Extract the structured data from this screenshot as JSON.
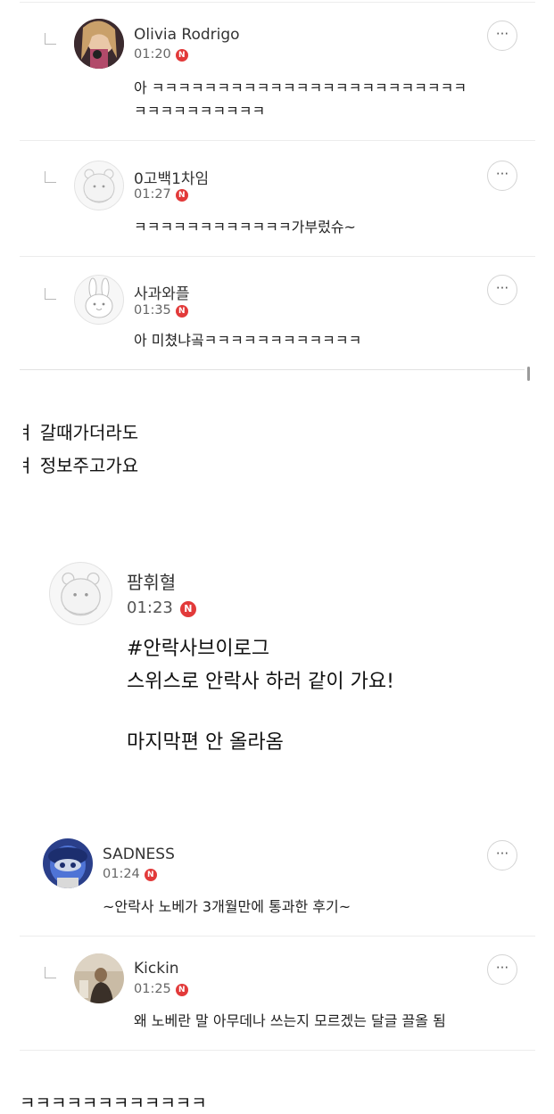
{
  "comments_top": [
    {
      "name": "Olivia Rodrigo",
      "time": "01:20",
      "text_line1": "아 ㅋㅋㅋㅋㅋㅋㅋㅋㅋㅋㅋㅋㅋㅋㅋㅋㅋㅋㅋㅋㅋㅋㅋㅋ",
      "text_line2": "ㅋㅋㅋㅋㅋㅋㅋㅋㅋㅋ"
    },
    {
      "name": "0고백1차임",
      "time": "01:27",
      "text_line1": "ㅋㅋㅋㅋㅋㅋㅋㅋㅋㅋㅋㅋ가부렀슈~"
    },
    {
      "name": "사과와플",
      "time": "01:35",
      "text_line1": "아 미쳤냐곸ㅋㅋㅋㅋㅋㅋㅋㅋㅋㅋㅋㅋ"
    }
  ],
  "badge_letter": "N",
  "more_label": "···",
  "mid_text": {
    "line1": "ㅕ 갈때가더라도",
    "line2": "ㅕ 정보주고가요"
  },
  "post": {
    "name": "팜휘혈",
    "time": "01:23",
    "body_line1": "#안락사브이로그",
    "body_line2": "스위스로 안락사 하러 같이 가요!",
    "body_line3": "마지막편 안 올라옴"
  },
  "comments_bottom": [
    {
      "name": "SADNESS",
      "time": "01:24",
      "text_line1": "~안락사 노베가 3개월만에 통과한 후기~"
    },
    {
      "name": "Kickin",
      "time": "01:25",
      "text_line1": "왜 노베란 말 아무데나 쓰는지 모르겠는 달글 끌올 됨"
    }
  ],
  "bottom_text": "ㅋㅋㅋㅋㅋㅋㅋㅋㅋㅋㅋㅋ",
  "colors": {
    "badge": "#e23a3a",
    "divider": "#ececec"
  }
}
